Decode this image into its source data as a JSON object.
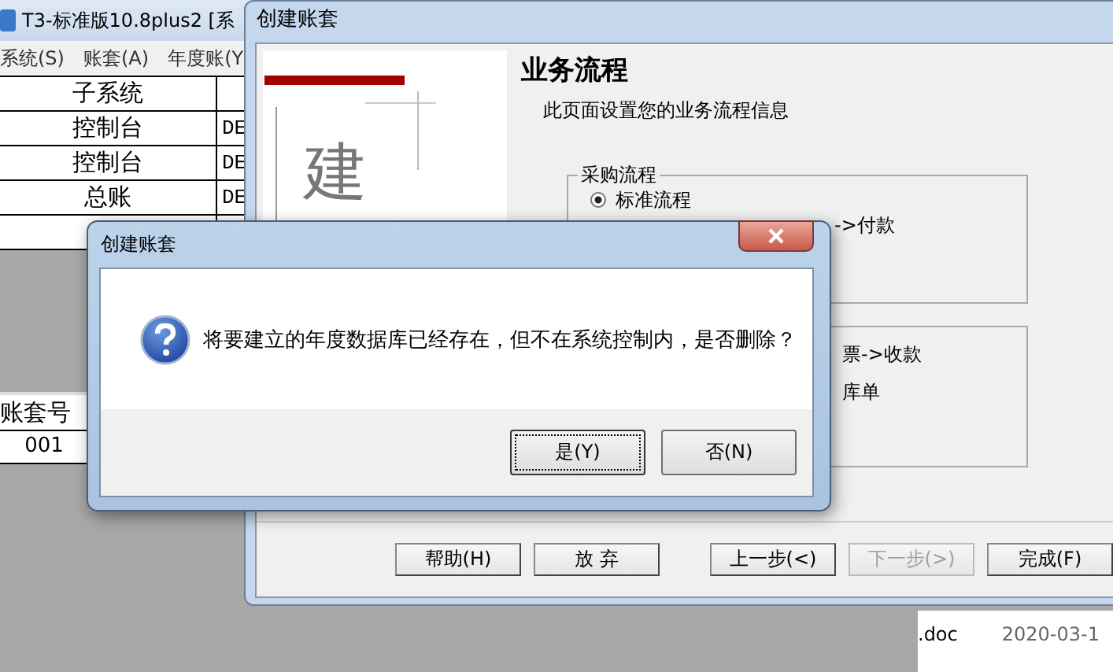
{
  "background_window": {
    "title": "T3-标准版10.8plus2 [系",
    "menu": [
      "系统(S)",
      "账套(A)",
      "年度账(Y"
    ],
    "subsystem_table": {
      "header": "子系统",
      "rows": [
        {
          "subsystem": "控制台",
          "column_2": "DE"
        },
        {
          "subsystem": "控制台",
          "column_2": "DE"
        },
        {
          "subsystem": "总账",
          "column_2": "DE"
        }
      ]
    },
    "account_table": {
      "header": "账套号",
      "rows": [
        "001"
      ]
    }
  },
  "wizard": {
    "title": "创建账套",
    "banner_glyph": "建",
    "heading": "业务流程",
    "subtitle": "此页面设置您的业务流程信息",
    "groups": [
      {
        "title": "采购流程",
        "options": [
          {
            "label": "标准流程",
            "selected": true
          }
        ],
        "lines": [
          "->付款"
        ]
      },
      {
        "lines": [
          "票->收款",
          "库单"
        ]
      }
    ],
    "buttons": [
      {
        "label": "帮助(H)",
        "disabled": false
      },
      {
        "label": "放 弃",
        "disabled": false
      },
      {
        "label": "上一步(<)",
        "disabled": false
      },
      {
        "label": "下一步(>)",
        "disabled": true
      },
      {
        "label": "完成(F)",
        "disabled": false
      }
    ]
  },
  "file_list": [
    {
      "name": ".doc",
      "date": "2020-03-1"
    }
  ],
  "message_box": {
    "title": "创建账套",
    "message": "将要建立的年度数据库已经存在，但不在系统控制内，是否删除？",
    "buttons": [
      {
        "label": "是(Y)",
        "default": true
      },
      {
        "label": "否(N)",
        "default": false
      }
    ]
  }
}
